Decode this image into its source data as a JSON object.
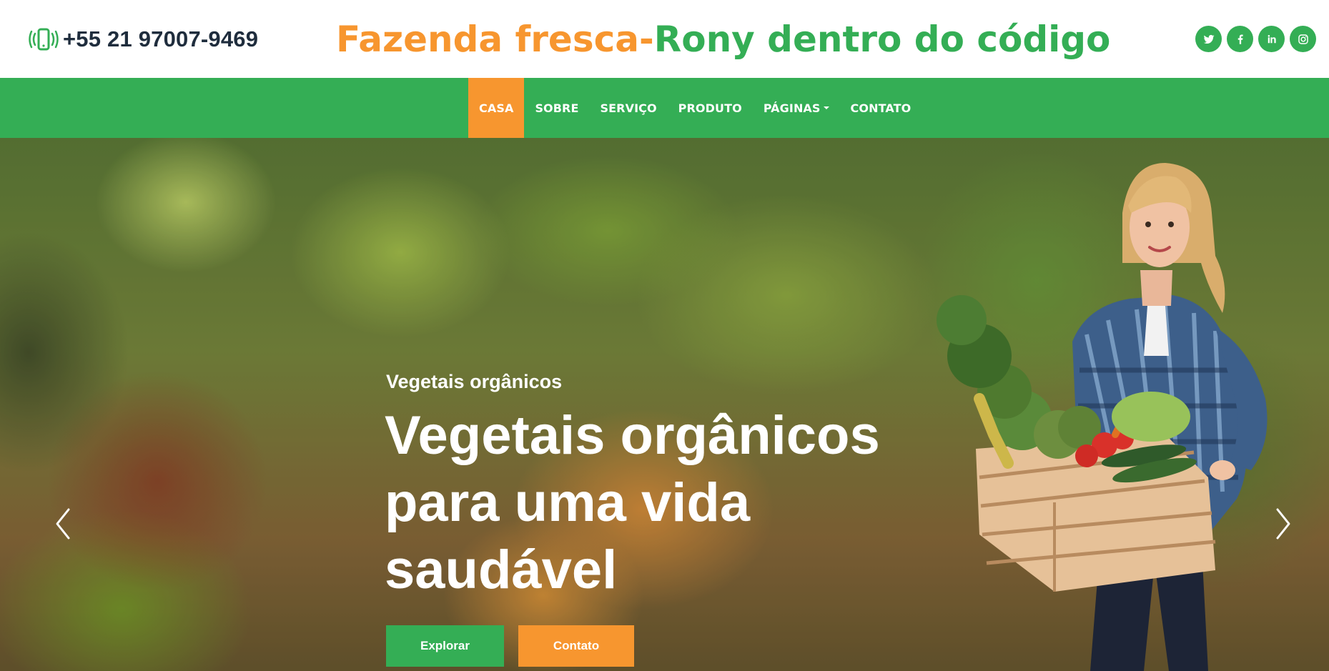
{
  "header": {
    "phone": "+55 21 97007-9469",
    "brand_part1": "Fazenda fresca-",
    "brand_part2": "Rony dentro do código",
    "socials": [
      {
        "icon": "twitter-icon"
      },
      {
        "icon": "facebook-icon"
      },
      {
        "icon": "linkedin-icon"
      },
      {
        "icon": "instagram-icon"
      }
    ]
  },
  "nav": {
    "items": [
      {
        "label": "CASA",
        "active": true
      },
      {
        "label": "SOBRE"
      },
      {
        "label": "SERVIÇO"
      },
      {
        "label": "PRODUTO"
      },
      {
        "label": "PÁGINAS",
        "dropdown": true
      },
      {
        "label": "CONTATO"
      }
    ]
  },
  "hero": {
    "kicker": "Vegetais orgânicos",
    "title": "Vegetais orgânicos para uma vida saudável",
    "buttons": {
      "explore": "Explorar",
      "contact": "Contato"
    }
  },
  "colors": {
    "green": "#34ae55",
    "orange": "#f7962f",
    "dark_text": "#1f2d3d"
  }
}
